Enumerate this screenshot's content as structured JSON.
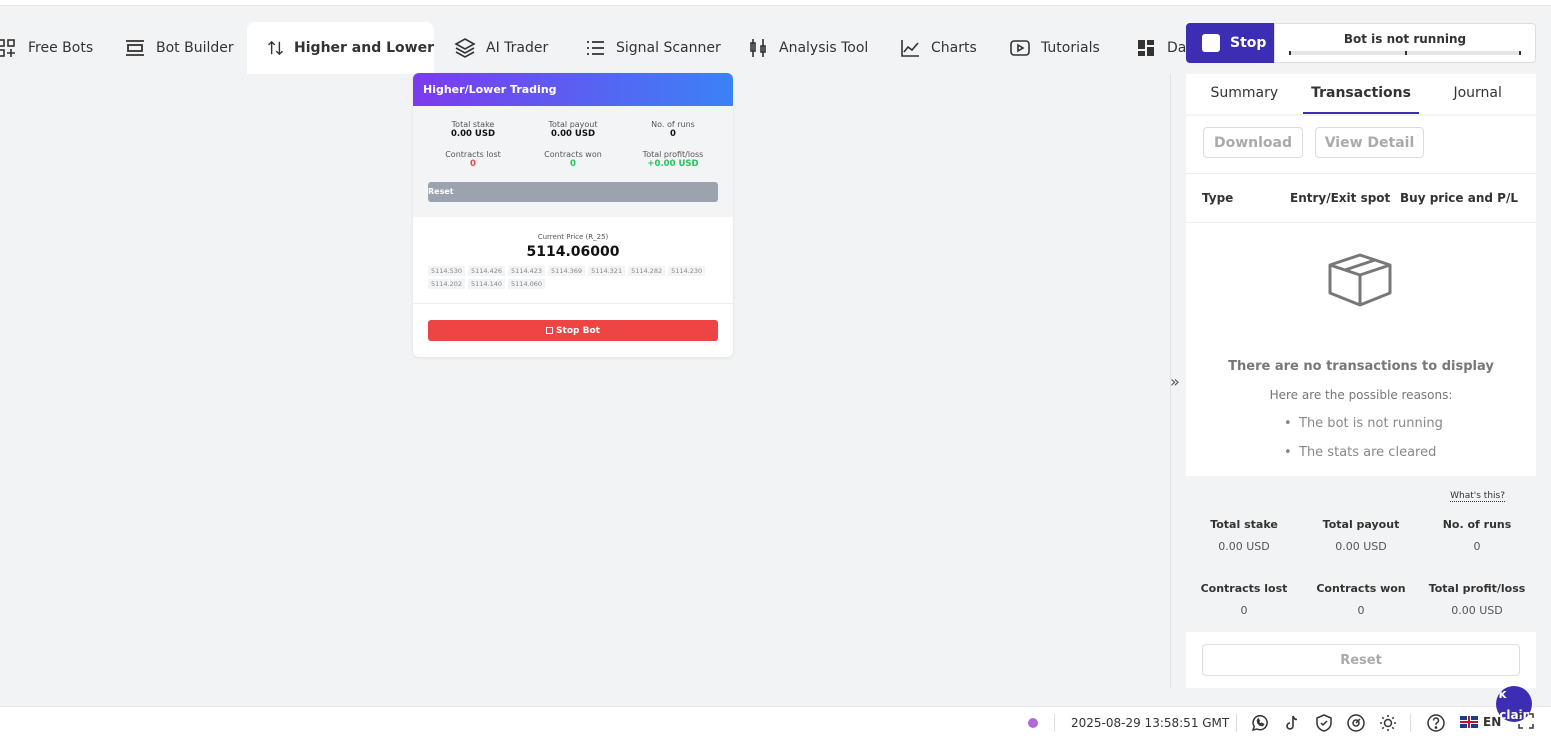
{
  "nav": {
    "items": [
      {
        "label": "Free Bots",
        "icon": "grid-plus-icon"
      },
      {
        "label": "Bot Builder",
        "icon": "builder-icon"
      },
      {
        "label": "Higher and Lower",
        "icon": "arrows-up-down-icon",
        "active": true
      },
      {
        "label": "AI Trader",
        "icon": "layers-icon"
      },
      {
        "label": "Signal Scanner",
        "icon": "list-icon"
      },
      {
        "label": "Analysis Tool",
        "icon": "candlestick-icon"
      },
      {
        "label": "Charts",
        "icon": "line-chart-icon"
      },
      {
        "label": "Tutorials",
        "icon": "play-icon"
      },
      {
        "label": "Das",
        "icon": "dashboard-icon"
      }
    ]
  },
  "run_panel": {
    "stop_label": "Stop",
    "status_text": "Bot is not running"
  },
  "card": {
    "title": "Higher/Lower Trading",
    "stats": {
      "total_stake_label": "Total stake",
      "total_stake": "0.00 USD",
      "total_payout_label": "Total payout",
      "total_payout": "0.00 USD",
      "runs_label": "No. of runs",
      "runs": "0",
      "lost_label": "Contracts lost",
      "lost": "0",
      "won_label": "Contracts won",
      "won": "0",
      "pl_label": "Total profit/loss",
      "pl": "+0.00 USD"
    },
    "reset_label": "Reset",
    "price_label": "Current Price (R_25)",
    "price": "5114.06000",
    "ticks": [
      "5114.530",
      "5114.426",
      "5114.423",
      "5114.369",
      "5114.321",
      "5114.282",
      "5114.230",
      "5114.202",
      "5114.140",
      "5114.060"
    ],
    "stop_label": "Stop Bot"
  },
  "panel": {
    "tabs": [
      "Summary",
      "Transactions",
      "Journal"
    ],
    "active_tab": "Transactions",
    "download_label": "Download",
    "view_detail_label": "View Detail",
    "columns": [
      "Type",
      "Entry/Exit spot",
      "Buy price and P/L"
    ],
    "empty_title": "There are no transactions to display",
    "empty_sub": "Here are the possible reasons:",
    "reasons": [
      "The bot is not running",
      "The stats are cleared"
    ],
    "whats_this": "What's this?",
    "summary": {
      "total_stake_label": "Total stake",
      "total_stake": "0.00 USD",
      "total_payout_label": "Total payout",
      "total_payout": "0.00 USD",
      "runs_label": "No. of runs",
      "runs": "0",
      "lost_label": "Contracts lost",
      "lost": "0",
      "won_label": "Contracts won",
      "won": "0",
      "pl_label": "Total profit/loss",
      "pl": "0.00 USD"
    },
    "reset_label": "Reset"
  },
  "footer": {
    "datetime": "2025-08-29 13:58:51 GMT",
    "language": "EN",
    "risk_text": "Risk Disclaimer"
  },
  "colors": {
    "accent": "#3c2db4",
    "danger": "#ef4444",
    "success": "#22c55e",
    "header_gradient_start": "#7c3aed",
    "header_gradient_end": "#3b82f6"
  }
}
